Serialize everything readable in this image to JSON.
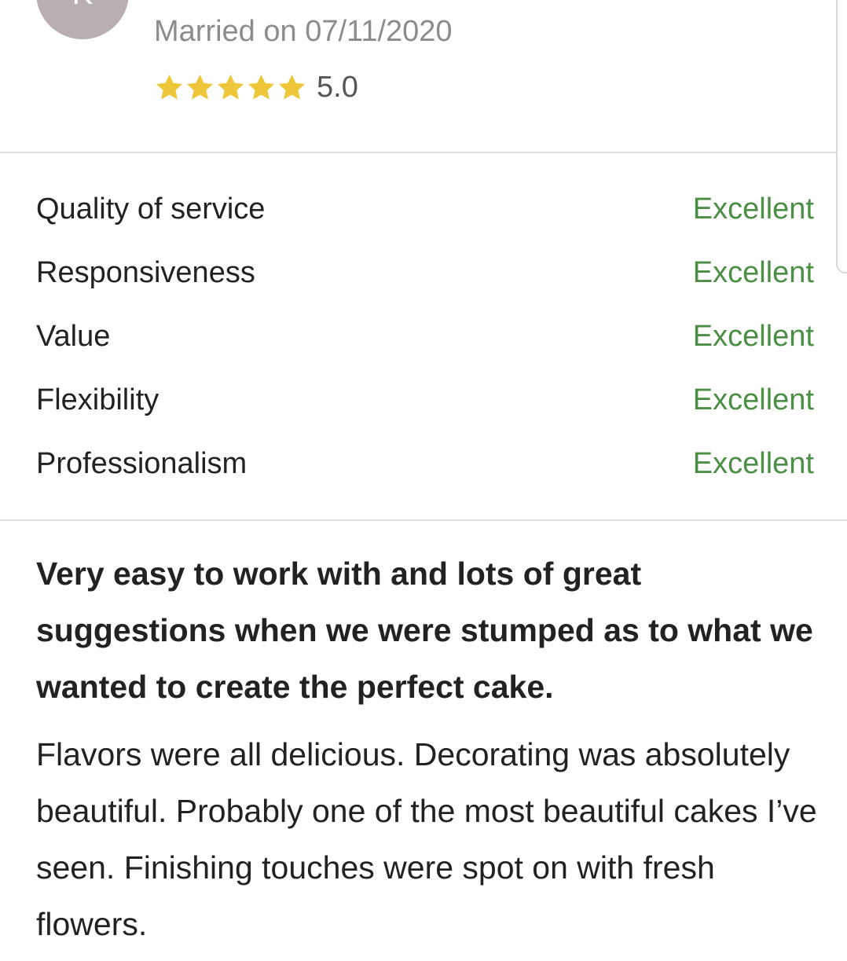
{
  "reviewer": {
    "avatar_initial": "K",
    "married_on": "Married on 07/11/2020",
    "rating_value": "5.0",
    "stars_filled": 5,
    "stars_total": 5,
    "star_color": "#eec63a"
  },
  "category_ratings": [
    {
      "label": "Quality of service",
      "grade": "Excellent"
    },
    {
      "label": "Responsiveness",
      "grade": "Excellent"
    },
    {
      "label": "Value",
      "grade": "Excellent"
    },
    {
      "label": "Flexibility",
      "grade": "Excellent"
    },
    {
      "label": "Professionalism",
      "grade": "Excellent"
    }
  ],
  "review": {
    "title": "Very easy to work with and lots of great suggestions when we were stumped as to what we wanted to create the perfect cake.",
    "body": "Flavors were all delicious. Decorating was absolutely beautiful. Probably one of the most beautiful cakes I’ve seen. Finishing touches were spot on with fresh flowers."
  },
  "colors": {
    "grade_text": "#4a8f44",
    "avatar_bg": "#b9aeb2",
    "muted_text": "#8c8c8c"
  }
}
